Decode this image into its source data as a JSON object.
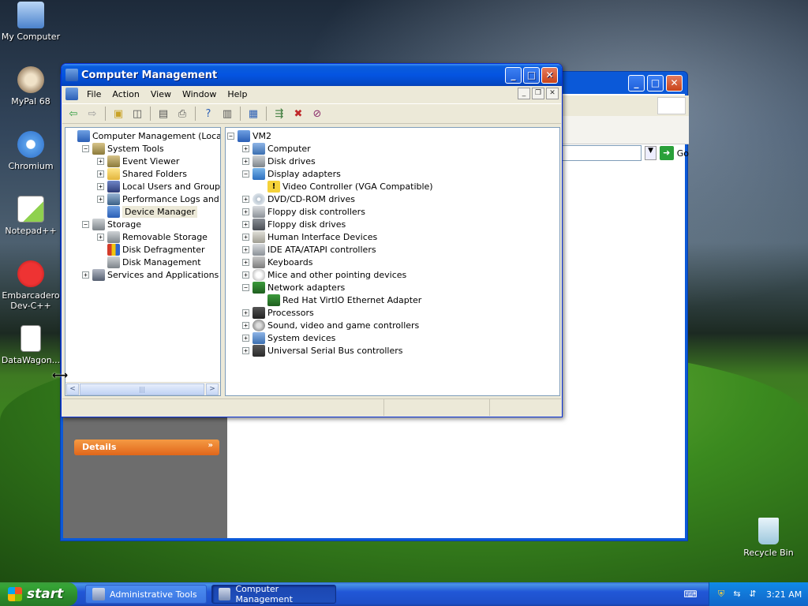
{
  "desktop": {
    "icons": [
      {
        "label": "My Computer",
        "icon": "my-computer-icon"
      },
      {
        "label": "MyPal 68",
        "icon": "mypal-icon"
      },
      {
        "label": "Chromium",
        "icon": "chromium-icon"
      },
      {
        "label": "Notepad++",
        "icon": "notepadpp-icon"
      },
      {
        "label": "Embarcadero Dev-C++",
        "icon": "devcpp-icon"
      },
      {
        "label": "DataWagon...",
        "icon": "document-icon"
      },
      {
        "label": "Recycle Bin",
        "icon": "recycle-bin-icon"
      }
    ]
  },
  "back_window": {
    "details_label": "Details",
    "details_chevron": "»",
    "go_label": "Go"
  },
  "window": {
    "title": "Computer Management",
    "title_buttons": {
      "minimize": "_",
      "maximize": "□",
      "close": "✕"
    },
    "menu": [
      "File",
      "Action",
      "View",
      "Window",
      "Help"
    ],
    "mdi_buttons": {
      "minimize": "_",
      "restore": "❐",
      "close": "✕"
    },
    "left_tree": [
      {
        "label": "Computer Management (Local)",
        "icon": "computer",
        "expander": "",
        "level": 0
      },
      {
        "label": "System Tools",
        "icon": "tool",
        "expander": "−",
        "level": 1
      },
      {
        "label": "Event Viewer",
        "icon": "tool",
        "expander": "+",
        "level": 2
      },
      {
        "label": "Shared Folders",
        "icon": "folder",
        "expander": "+",
        "level": 2
      },
      {
        "label": "Local Users and Groups",
        "icon": "users",
        "expander": "+",
        "level": 2
      },
      {
        "label": "Performance Logs and Alerts",
        "icon": "perf",
        "expander": "+",
        "level": 2
      },
      {
        "label": "Device Manager",
        "icon": "computer",
        "expander": "",
        "level": 2,
        "selected": true
      },
      {
        "label": "Storage",
        "icon": "disk",
        "expander": "−",
        "level": 1
      },
      {
        "label": "Removable Storage",
        "icon": "disk",
        "expander": "+",
        "level": 2
      },
      {
        "label": "Disk Defragmenter",
        "icon": "defrag",
        "expander": "",
        "level": 2
      },
      {
        "label": "Disk Management",
        "icon": "disk",
        "expander": "",
        "level": 2
      },
      {
        "label": "Services and Applications",
        "icon": "services",
        "expander": "+",
        "level": 1
      }
    ],
    "right_tree": [
      {
        "label": "VM2",
        "icon": "computer",
        "expander": "−",
        "level": 0
      },
      {
        "label": "Computer",
        "icon": "sys",
        "expander": "+",
        "level": 1
      },
      {
        "label": "Disk drives",
        "icon": "disk",
        "expander": "+",
        "level": 1
      },
      {
        "label": "Display adapters",
        "icon": "display",
        "expander": "−",
        "level": 1
      },
      {
        "label": "Video Controller (VGA Compatible)",
        "icon": "warn",
        "expander": "",
        "level": 2
      },
      {
        "label": "DVD/CD-ROM drives",
        "icon": "cd",
        "expander": "+",
        "level": 1
      },
      {
        "label": "Floppy disk controllers",
        "icon": "ide",
        "expander": "+",
        "level": 1
      },
      {
        "label": "Floppy disk drives",
        "icon": "floppy",
        "expander": "+",
        "level": 1
      },
      {
        "label": "Human Interface Devices",
        "icon": "hid",
        "expander": "+",
        "level": 1
      },
      {
        "label": "IDE ATA/ATAPI controllers",
        "icon": "ide",
        "expander": "+",
        "level": 1
      },
      {
        "label": "Keyboards",
        "icon": "kbd",
        "expander": "+",
        "level": 1
      },
      {
        "label": "Mice and other pointing devices",
        "icon": "mouse",
        "expander": "+",
        "level": 1
      },
      {
        "label": "Network adapters",
        "icon": "net",
        "expander": "−",
        "level": 1
      },
      {
        "label": "Red Hat VirtIO Ethernet Adapter",
        "icon": "net",
        "expander": "",
        "level": 2
      },
      {
        "label": "Processors",
        "icon": "cpu",
        "expander": "+",
        "level": 1
      },
      {
        "label": "Sound, video and game controllers",
        "icon": "sound",
        "expander": "+",
        "level": 1
      },
      {
        "label": "System devices",
        "icon": "sys",
        "expander": "+",
        "level": 1
      },
      {
        "label": "Universal Serial Bus controllers",
        "icon": "usb",
        "expander": "+",
        "level": 1
      }
    ],
    "scroll_arrows": {
      "left": "<",
      "right": ">",
      "thumb": "|||"
    }
  },
  "taskbar": {
    "start_label": "start",
    "tasks": [
      {
        "label": "Administrative Tools",
        "icon": "admin-tools-icon"
      },
      {
        "label": "Computer Management",
        "icon": "computer-management-icon"
      }
    ],
    "clock": "3:21 AM"
  },
  "colors": {
    "title_blue": "#0454e1",
    "start_green": "#36a536",
    "details_orange": "#e0661a"
  }
}
